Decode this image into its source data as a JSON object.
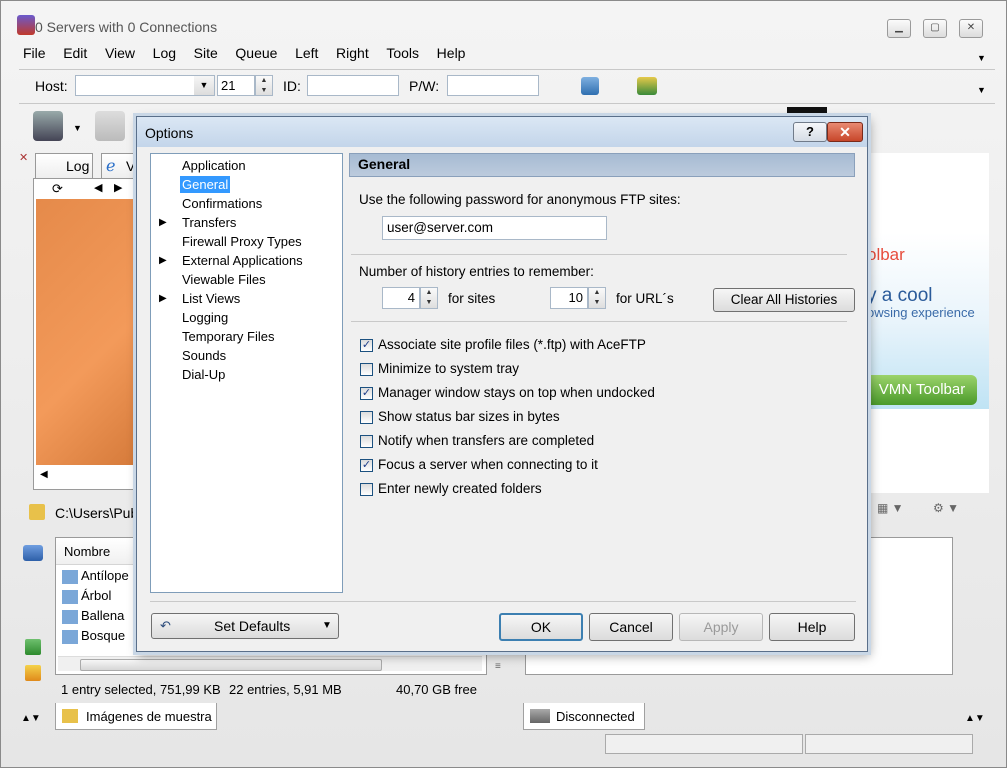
{
  "app": {
    "title": "0 Servers with 0 Connections",
    "menu": [
      "File",
      "Edit",
      "View",
      "Log",
      "Site",
      "Queue",
      "Left",
      "Right",
      "Tools",
      "Help"
    ],
    "host_label": "Host:",
    "port": "21",
    "id_label": "ID:",
    "pw_label": "P/W:"
  },
  "left_panel": {
    "tabs": [
      "Log",
      "V"
    ],
    "path": "C:\\Users\\Pub",
    "column_header": "Nombre",
    "files": [
      "Antílope",
      "Árbol",
      "Ballena",
      "Bosque"
    ],
    "status_selected": "1 entry selected, 751,99 KB",
    "status_count": "22 entries, 5,91 MB",
    "status_free": "40,70 GB free",
    "folder_tab": "Imágenes de muestra"
  },
  "right_panel": {
    "banner_brand": "olbar",
    "banner_text1": "y a cool",
    "banner_text2": "owsing experience",
    "banner_button": "VMN Toolbar",
    "status": "Disconnected"
  },
  "dialog": {
    "title": "Options",
    "help_label": "?",
    "close_label": "✕",
    "tree": [
      {
        "label": "Application",
        "arrow": false
      },
      {
        "label": "General",
        "arrow": false,
        "selected": true
      },
      {
        "label": "Confirmations",
        "arrow": false
      },
      {
        "label": "Transfers",
        "arrow": true
      },
      {
        "label": "Firewall Proxy Types",
        "arrow": false
      },
      {
        "label": "External Applications",
        "arrow": true
      },
      {
        "label": "Viewable Files",
        "arrow": false
      },
      {
        "label": "List Views",
        "arrow": true
      },
      {
        "label": "Logging",
        "arrow": false
      },
      {
        "label": "Temporary Files",
        "arrow": false
      },
      {
        "label": "Sounds",
        "arrow": false
      },
      {
        "label": "Dial-Up",
        "arrow": false
      }
    ],
    "page_title": "General",
    "anon_label": "Use the following password for anonymous FTP sites:",
    "anon_value": "user@server.com",
    "history_label": "Number of history entries to remember:",
    "sites_value": "4",
    "sites_label": "for sites",
    "urls_value": "10",
    "urls_label": "for URL´s",
    "clear_histories": "Clear All Histories",
    "checkboxes": [
      {
        "label": "Associate site profile files (*.ftp) with AceFTP",
        "checked": true
      },
      {
        "label": "Minimize to system tray",
        "checked": false
      },
      {
        "label": "Manager window stays on top when undocked",
        "checked": true
      },
      {
        "label": "Show status bar sizes in bytes",
        "checked": false
      },
      {
        "label": "Notify when transfers are completed",
        "checked": false
      },
      {
        "label": "Focus a server when connecting to it",
        "checked": true
      },
      {
        "label": "Enter newly created folders",
        "checked": false
      }
    ],
    "set_defaults": "Set Defaults",
    "ok": "OK",
    "cancel": "Cancel",
    "apply": "Apply",
    "help": "Help"
  }
}
